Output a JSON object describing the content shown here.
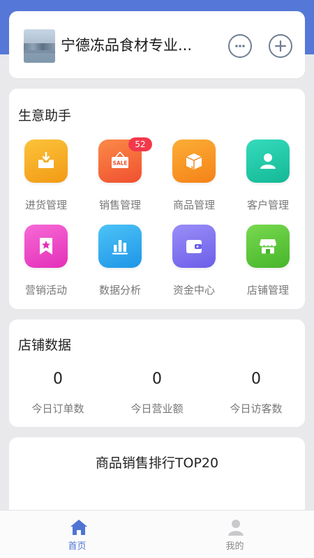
{
  "header": {
    "store_name": "宁德冻品食材专业..."
  },
  "assistant": {
    "title": "生意助手",
    "items": [
      {
        "label": "进货管理",
        "icon": "purchase-tray-icon",
        "color": "#f7a21f"
      },
      {
        "label": "销售管理",
        "icon": "sale-sign-icon",
        "color": "#f46a3c",
        "badge": "52"
      },
      {
        "label": "商品管理",
        "icon": "product-box-icon",
        "color": "#f7921c"
      },
      {
        "label": "客户管理",
        "icon": "customer-person-icon",
        "color": "#23c8a6"
      },
      {
        "label": "营销活动",
        "icon": "marketing-star-icon",
        "color": "#ec44c6"
      },
      {
        "label": "数据分析",
        "icon": "bar-chart-icon",
        "color": "#2fa8ee"
      },
      {
        "label": "资金中心",
        "icon": "wallet-icon",
        "color": "#7b6ef0"
      },
      {
        "label": "店铺管理",
        "icon": "storefront-icon",
        "color": "#5ec93c"
      }
    ]
  },
  "store_data": {
    "title": "店铺数据",
    "stats": [
      {
        "value": "0",
        "label": "今日订单数"
      },
      {
        "value": "0",
        "label": "今日营业额"
      },
      {
        "value": "0",
        "label": "今日访客数"
      }
    ]
  },
  "ranking": {
    "title": "商品销售排行TOP20"
  },
  "nav": {
    "home_label": "首页",
    "mine_label": "我的"
  },
  "colors": {
    "header_band": "#5577d8",
    "accent": "#4f74d3",
    "badge": "#f2394b"
  }
}
